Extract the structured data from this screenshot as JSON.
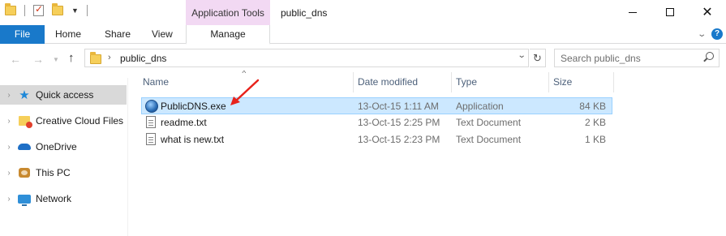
{
  "title_bar": {
    "window_title": "public_dns",
    "context_group": "Application Tools"
  },
  "ribbon": {
    "tabs": {
      "file": "File",
      "home": "Home",
      "share": "Share",
      "view": "View",
      "manage": "Manage"
    },
    "accent_color": "#1979ca",
    "context_color": "#f2d9f3"
  },
  "address_bar": {
    "path": "public_dns",
    "search_placeholder": "Search public_dns"
  },
  "nav_pane": {
    "items": [
      {
        "label": "Quick access",
        "icon": "star-icon",
        "selected": true
      },
      {
        "label": "Creative Cloud Files",
        "icon": "creative-cloud-icon",
        "selected": false
      },
      {
        "label": "OneDrive",
        "icon": "onedrive-icon",
        "selected": false
      },
      {
        "label": "This PC",
        "icon": "this-pc-icon",
        "selected": false
      },
      {
        "label": "Network",
        "icon": "network-icon",
        "selected": false
      }
    ]
  },
  "file_list": {
    "columns": {
      "name": "Name",
      "date": "Date modified",
      "type": "Type",
      "size": "Size"
    },
    "rows": [
      {
        "name": "PublicDNS.exe",
        "date": "13-Oct-15 1:11 AM",
        "type": "Application",
        "size": "84 KB",
        "icon": "application-icon",
        "selected": true
      },
      {
        "name": "readme.txt",
        "date": "13-Oct-15 2:25 PM",
        "type": "Text Document",
        "size": "2 KB",
        "icon": "text-document-icon",
        "selected": false
      },
      {
        "name": "what is new.txt",
        "date": "13-Oct-15 2:23 PM",
        "type": "Text Document",
        "size": "1 KB",
        "icon": "text-document-icon",
        "selected": false
      }
    ]
  },
  "annotation": {
    "color": "#e8221b"
  }
}
